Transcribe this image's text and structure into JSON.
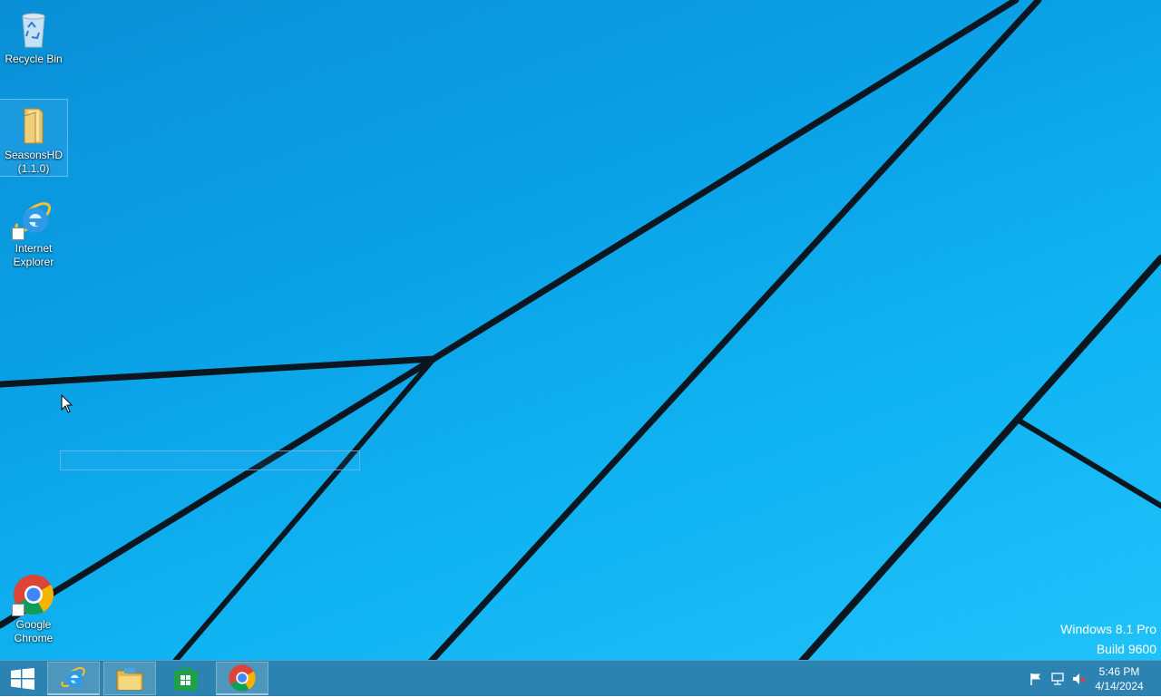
{
  "desktop": {
    "icons": [
      {
        "label": "Recycle Bin",
        "icon": "recycle-bin-icon"
      },
      {
        "label": "SeasonsHD\n(1.1.0)",
        "icon": "folder-icon"
      },
      {
        "label": "Internet\nExplorer",
        "icon": "internet-explorer-icon"
      },
      {
        "label": "Google\nChrome",
        "icon": "chrome-icon"
      }
    ],
    "watermark": {
      "line1": "Windows 8.1 Pro",
      "line2": "Build 9600"
    }
  },
  "taskbar": {
    "start": {
      "icon": "windows-logo-icon"
    },
    "items": [
      {
        "icon": "internet-explorer-icon"
      },
      {
        "icon": "file-explorer-icon"
      },
      {
        "icon": "windows-store-icon"
      },
      {
        "icon": "chrome-icon"
      }
    ],
    "tray": {
      "icons": [
        "action-center-flag-icon",
        "network-icon",
        "volume-muted-icon"
      ],
      "time": "5:46 PM",
      "date": "4/14/2024"
    }
  },
  "colors": {
    "wallpaper": "#10b3f2",
    "taskbar": "#1c78aa",
    "wallpaper_lines": "#0a1a24"
  }
}
